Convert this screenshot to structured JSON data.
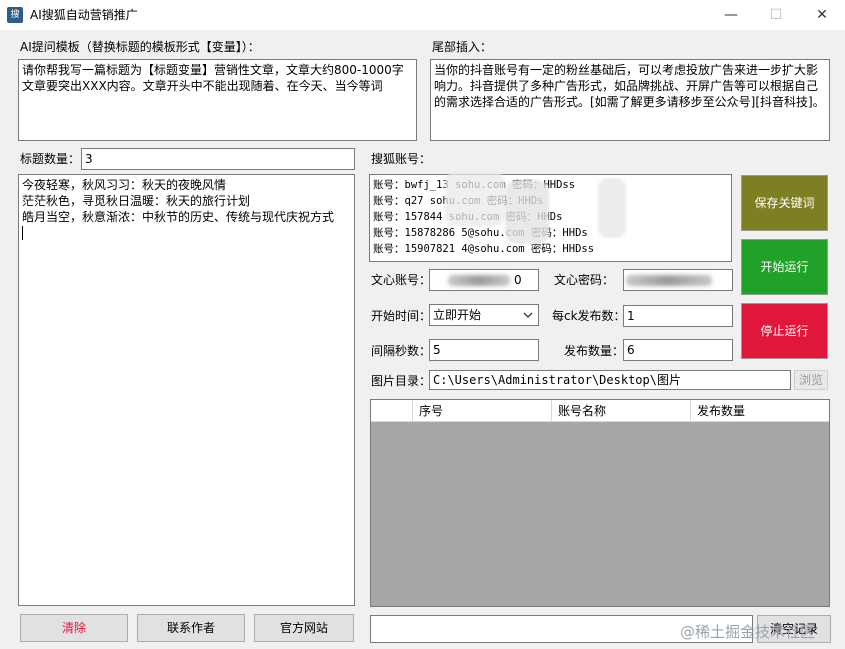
{
  "window": {
    "title": "AI搜狐自动营销推广",
    "icon_text": "搜",
    "minimize": "—",
    "maximize": "☐",
    "close": "✕"
  },
  "template": {
    "label": "AI提问模板（替换标题的模板形式【变量】）：",
    "text": "请你帮我写一篇标题为【标题变量】营销性文章，文章大约800-1000字文章要突出XXX内容。文章开头中不能出现随着、在今天、当今等词"
  },
  "tail": {
    "label": "尾部插入：",
    "text": "当你的抖音账号有一定的粉丝基础后，可以考虑投放广告来进一步扩大影响力。抖音提供了多种广告形式，如品牌挑战、开屏广告等可以根据自己的需求选择合适的广告形式。[如需了解更多请移步至公众号][抖音科技]。"
  },
  "titles": {
    "count_label": "标题数量：",
    "count_value": "3",
    "items": [
      "今夜轻寒，秋风习习：秋天的夜晚风情",
      "茫茫秋色，寻觅秋日温暖：秋天的旅行计划",
      "皓月当空，秋意渐浓：中秋节的历史、传统与现代庆祝方式"
    ]
  },
  "accounts": {
    "label": "搜狐账号：",
    "lines": [
      "账号：bwfj_13    sohu.com 密码：HHDss",
      "账号：q27        sohu.com 密码：HHDs",
      "账号：157844     sohu.com 密码：HHDs",
      "账号：15878286  5@sohu.com 密码：HHDs",
      "账号：15907821  4@sohu.com 密码：HHDss"
    ]
  },
  "buttons": {
    "save_keywords": "保存关键词",
    "start": "开始运行",
    "stop": "停止运行",
    "clear": "清除",
    "contact": "联系作者",
    "website": "官方网站",
    "browse": "浏览",
    "clear_log": "清空记录"
  },
  "settings": {
    "wenxin_account_label": "文心账号：",
    "wenxin_account_value": "0",
    "wenxin_password_label": "文心密码：",
    "wenxin_password_value": "",
    "start_time_label": "开始时间：",
    "start_time_value": "立即开始",
    "per_ck_label": "每ck发布数：",
    "per_ck_value": "1",
    "interval_label": "间隔秒数：",
    "interval_value": "5",
    "publish_count_label": "发布数量：",
    "publish_count_value": "6",
    "image_dir_label": "图片目录：",
    "image_dir_value": "C:\\Users\\Administrator\\Desktop\\图片"
  },
  "grid": {
    "columns": [
      "序号",
      "账号名称",
      "发布数量"
    ]
  },
  "watermark": "@稀土掘金技术社区",
  "colors": {
    "save_button": "#7e7f22",
    "start_button": "#22a12a",
    "stop_button": "#e0163b",
    "clear_text": "#e0163b",
    "grid_body": "#a6a6a6"
  }
}
